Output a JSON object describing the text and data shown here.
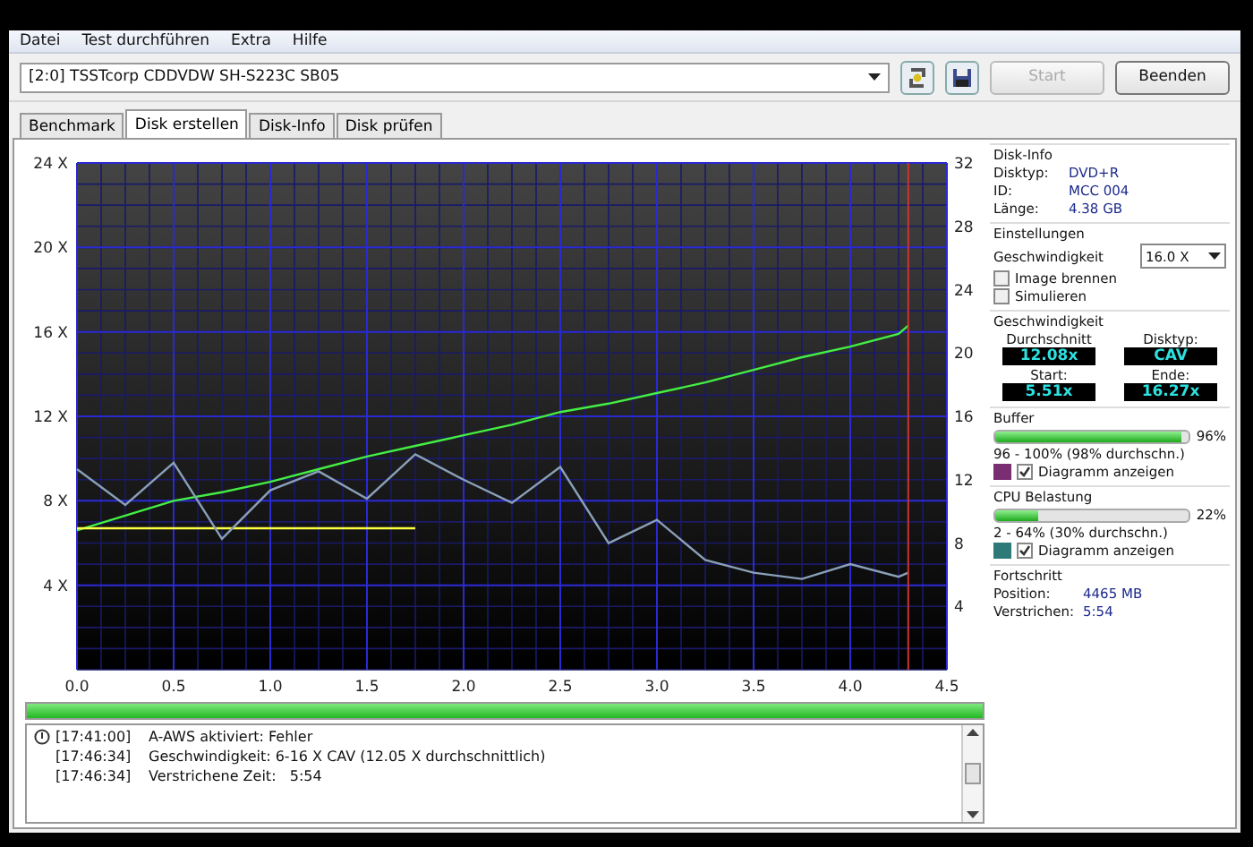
{
  "menu": [
    "Datei",
    "Test durchführen",
    "Extra",
    "Hilfe"
  ],
  "toolbar": {
    "drive": "[2:0]  TSSTcorp CDDVDW SH-S223C SB05",
    "start": {
      "label": "Start",
      "disabled": true
    },
    "quit": {
      "label": "Beenden",
      "disabled": false
    }
  },
  "tabs": [
    {
      "label": "Benchmark",
      "selected": false
    },
    {
      "label": "Disk erstellen",
      "selected": true
    },
    {
      "label": "Disk-Info",
      "selected": false
    },
    {
      "label": "Disk prüfen",
      "selected": false
    }
  ],
  "chart_data": {
    "type": "line",
    "x": [
      0,
      0.25,
      0.5,
      0.75,
      1.0,
      1.25,
      1.5,
      1.75,
      2.0,
      2.25,
      2.5,
      2.75,
      3.0,
      3.25,
      3.5,
      3.75,
      4.0,
      4.25,
      4.3
    ],
    "xlim": [
      0,
      4.5
    ],
    "ylim": [
      0,
      24
    ],
    "grid": true,
    "xticks": [
      {
        "value": 0,
        "label": "0.0"
      },
      {
        "value": 0.5,
        "label": "0.5"
      },
      {
        "value": 1,
        "label": "1.0"
      },
      {
        "value": 1.5,
        "label": "1.5"
      },
      {
        "value": 2,
        "label": "2.0"
      },
      {
        "value": 2.5,
        "label": "2.5"
      },
      {
        "value": 3,
        "label": "3.0"
      },
      {
        "value": 3.5,
        "label": "3.5"
      },
      {
        "value": 4,
        "label": "4.0"
      },
      {
        "value": 4.5,
        "label": "4.5"
      }
    ],
    "yticks": [
      {
        "value": 4,
        "label": "4 X"
      },
      {
        "value": 8,
        "label": "8 X"
      },
      {
        "value": 12,
        "label": "12 X"
      },
      {
        "value": 16,
        "label": "16 X"
      },
      {
        "value": 20,
        "label": "20 X"
      },
      {
        "value": 24,
        "label": "24 X"
      }
    ],
    "series": [
      {
        "color": "#44ee44",
        "values": [
          6.6,
          7.3,
          8.0,
          8.4,
          8.9,
          9.5,
          10.1,
          10.6,
          11.1,
          11.6,
          12.2,
          12.6,
          13.1,
          13.6,
          14.2,
          14.8,
          15.3,
          15.9,
          16.3
        ]
      },
      {
        "color": "#ffff44",
        "values": [
          6.7,
          6.7,
          6.7,
          6.7,
          6.7,
          6.7,
          6.7,
          6.7,
          null,
          null,
          null,
          null,
          null,
          null,
          null,
          null,
          null,
          null,
          null
        ]
      },
      {
        "color": "#8aa0b8",
        "values": [
          9.5,
          7.8,
          9.8,
          6.2,
          8.5,
          9.4,
          8.1,
          10.2,
          9.0,
          7.9,
          9.6,
          6.0,
          7.1,
          5.2,
          4.6,
          4.3,
          5.0,
          4.4,
          4.6
        ]
      }
    ],
    "ref_lines": [
      {
        "axis": "x",
        "value": 4.3,
        "color": "#cc3333"
      }
    ]
  },
  "right_axis": [
    "32",
    "28",
    "24",
    "20",
    "16",
    "12",
    "8",
    "4"
  ],
  "progress": {
    "level": 1.0
  },
  "log": [
    {
      "time": "[17:41:00]",
      "text": "A-AWS aktiviert: Fehler",
      "kind": "info"
    },
    {
      "time": "[17:46:34]",
      "text": "Geschwindigkeit: 6-16 X CAV (12.05 X durchschnittlich)",
      "kind": "plain"
    },
    {
      "time": "[17:46:34]",
      "text": "Verstrichene Zeit:   5:54",
      "kind": "plain"
    }
  ],
  "disk_info": {
    "title": "Disk-Info",
    "rows": [
      {
        "label": "Disktyp:",
        "value": "DVD+R"
      },
      {
        "label": "ID:",
        "value": "MCC 004"
      },
      {
        "label": "Länge:",
        "value": "4.38 GB"
      }
    ]
  },
  "settings": {
    "title": "Einstellungen",
    "speed_label": "Geschwindigkeit",
    "speed_value": "16.0 X",
    "options": [
      {
        "label": "Image brennen",
        "checked": false
      },
      {
        "label": "Simulieren",
        "checked": false
      }
    ]
  },
  "speed": {
    "title": "Geschwindigkeit",
    "cells": [
      {
        "label": "Durchschnitt",
        "value": "12.08x"
      },
      {
        "label": "Disktyp:",
        "value": "CAV"
      },
      {
        "label": "Start:",
        "value": "5.51x"
      },
      {
        "label": "Ende:",
        "value": "16.27x"
      }
    ]
  },
  "buffer": {
    "title": "Buffer",
    "level": 0.96,
    "percent": "96%",
    "range": "96 - 100% (98% durchschn.)",
    "color": "#7a2e72",
    "show_chart": {
      "label": "Diagramm anzeigen",
      "checked": true
    }
  },
  "cpu": {
    "title": "CPU Belastung",
    "level": 0.22,
    "percent": "22%",
    "range": "2 - 64% (30% durchschn.)",
    "color": "#2e7a78",
    "show_chart": {
      "label": "Diagramm anzeigen",
      "checked": true
    }
  },
  "progress_info": {
    "title": "Fortschritt",
    "rows": [
      {
        "label": "Position:",
        "value": "4465 MB"
      },
      {
        "label": "Verstrichen:",
        "value": "5:54"
      }
    ]
  }
}
